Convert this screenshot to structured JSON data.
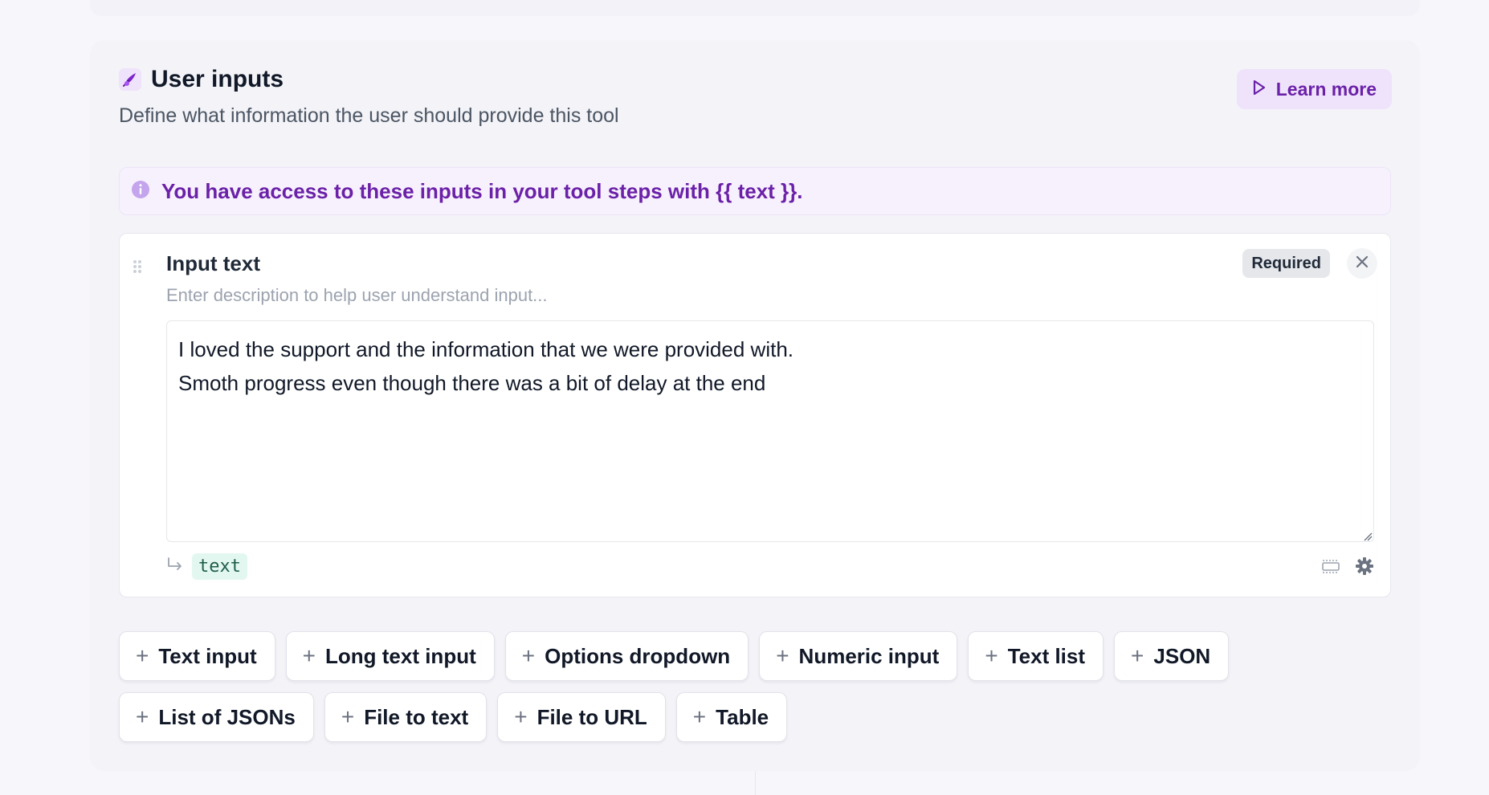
{
  "header": {
    "title": "User inputs",
    "subtitle": "Define what information the user should provide this tool",
    "learn_more_label": "Learn more"
  },
  "info_banner": {
    "text": "You have access to these inputs in your tool steps with {{ text }}."
  },
  "input_card": {
    "title": "Input text",
    "description_placeholder": "Enter description to help user understand input...",
    "required_label": "Required",
    "value": "I loved the support and the information that we were provided with.\nSmoth progress even though there was a bit of delay at the end",
    "variable_name": "text"
  },
  "add_buttons_row1": [
    "Text input",
    "Long text input",
    "Options dropdown",
    "Numeric input",
    "Text list",
    "JSON"
  ],
  "add_buttons_row2": [
    "List of JSONs",
    "File to text",
    "File to URL",
    "Table"
  ],
  "icons": {
    "header": "feather-pen-icon",
    "learn_more": "play-icon",
    "info": "info-icon",
    "drag": "drag-handle-icon",
    "close": "close-icon",
    "variable": "return-arrow-icon",
    "layout": "input-layout-icon",
    "settings": "gear-icon",
    "add": "plus-icon"
  },
  "colors": {
    "accent": "#6b21a8",
    "accent_bg": "#efe3fb",
    "chip_bg": "#e3f7f1"
  }
}
